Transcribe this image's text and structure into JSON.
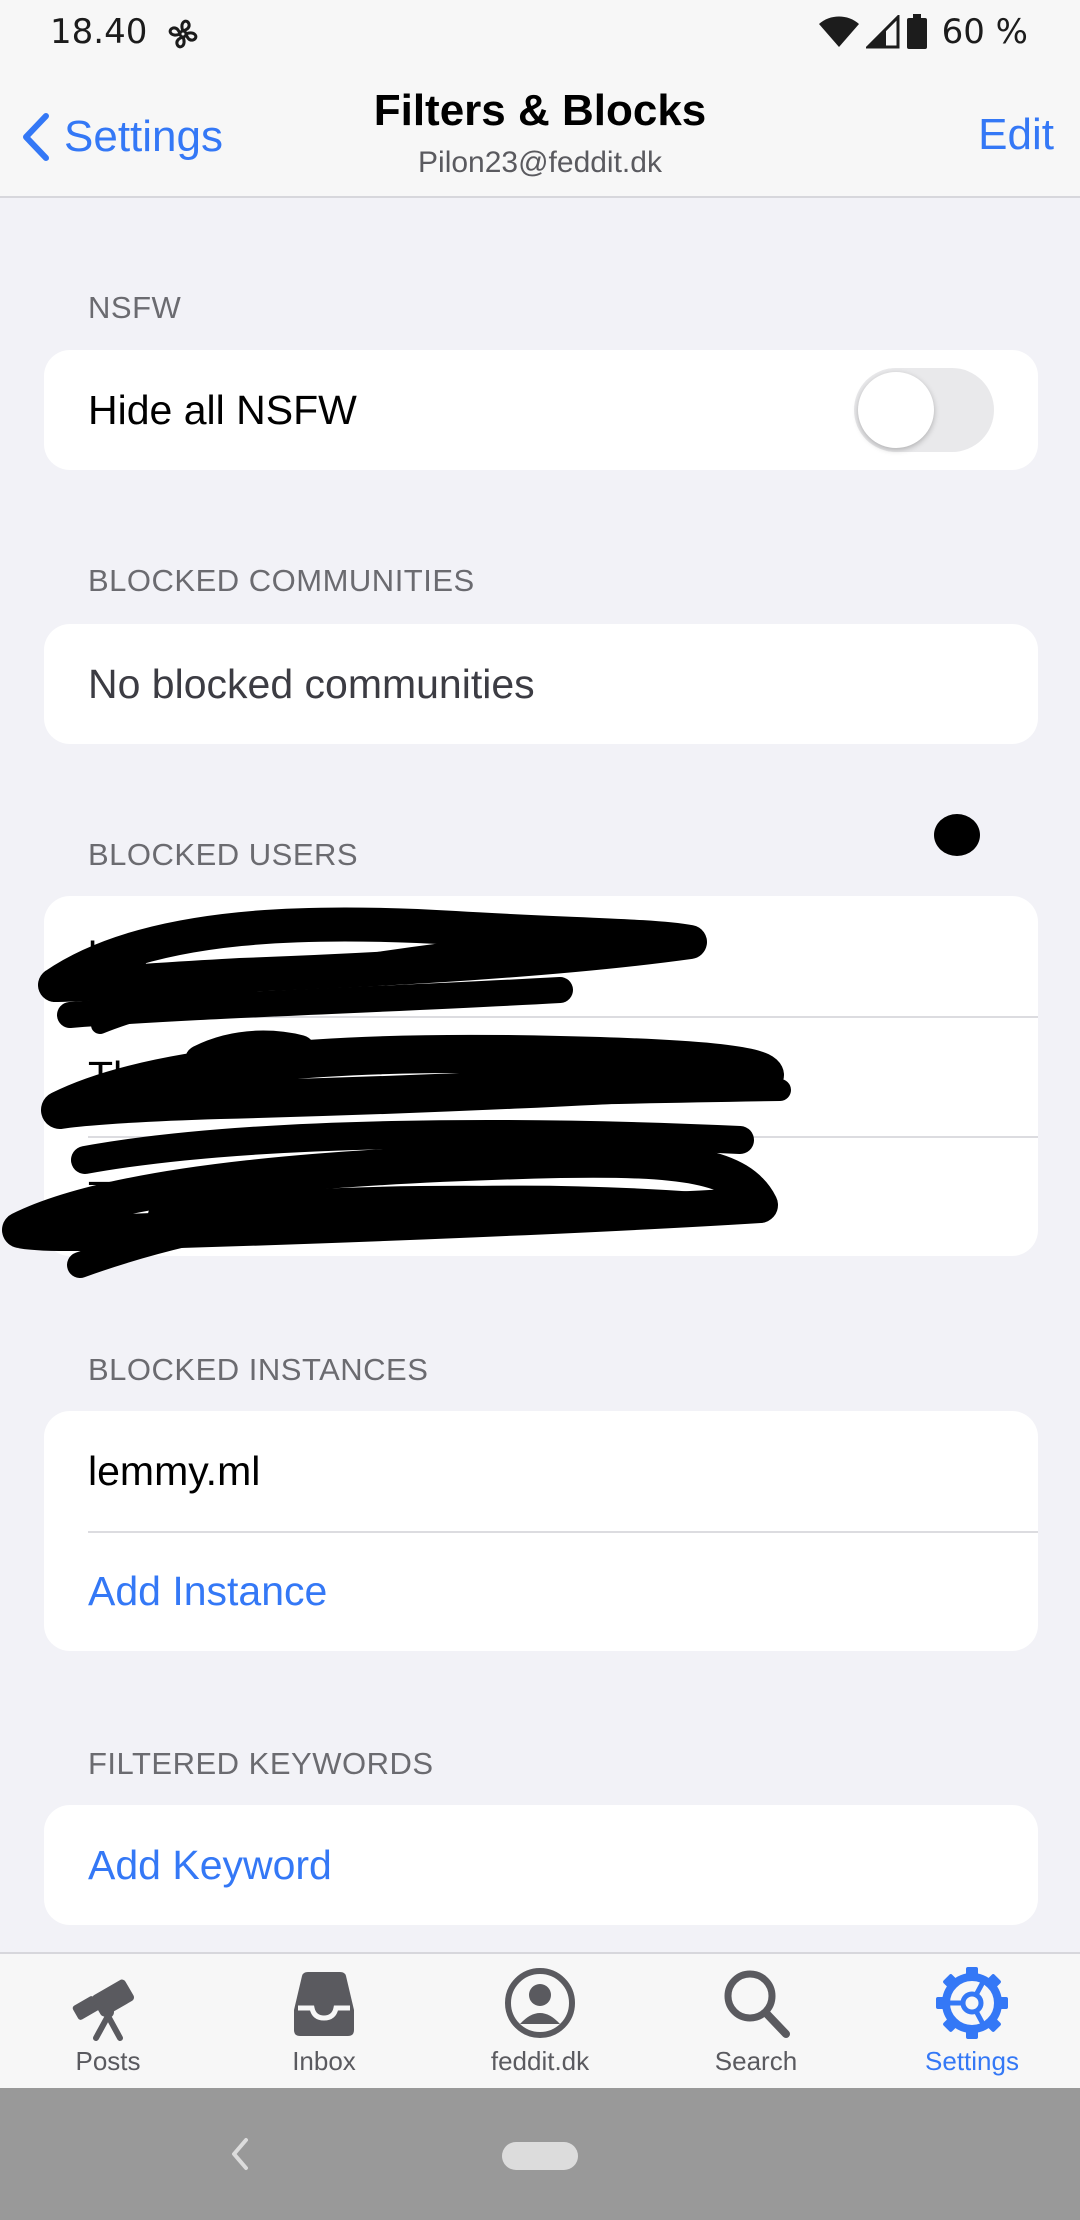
{
  "status_bar": {
    "time": "18.40",
    "battery_text": "60 %"
  },
  "nav": {
    "back_label": "Settings",
    "title": "Filters & Blocks",
    "subtitle": "Pilon23@feddit.dk",
    "edit_label": "Edit"
  },
  "sections": {
    "nsfw": {
      "header": "NSFW",
      "hide_label": "Hide all NSFW",
      "hide_enabled": false
    },
    "blocked_communities": {
      "header": "BLOCKED COMMUNITIES",
      "empty_text": "No blocked communities"
    },
    "blocked_users": {
      "header": "BLOCKED USERS",
      "items": [
        "kay",
        "Thr",
        "Thr"
      ]
    },
    "blocked_instances": {
      "header": "BLOCKED INSTANCES",
      "items": [
        "lemmy.ml"
      ],
      "add_label": "Add Instance"
    },
    "filtered_keywords": {
      "header": "FILTERED KEYWORDS",
      "add_label": "Add Keyword"
    }
  },
  "tabs": [
    {
      "label": "Posts",
      "icon": "telescope-icon",
      "active": false
    },
    {
      "label": "Inbox",
      "icon": "inbox-tray-icon",
      "active": false
    },
    {
      "label": "feddit.dk",
      "icon": "person-circle-icon",
      "active": false
    },
    {
      "label": "Search",
      "icon": "magnifier-icon",
      "active": false
    },
    {
      "label": "Settings",
      "icon": "gear-icon",
      "active": true
    }
  ],
  "colors": {
    "accent": "#3478f6",
    "background": "#f2f2f7",
    "card": "#ffffff",
    "system_nav": "#999999"
  }
}
